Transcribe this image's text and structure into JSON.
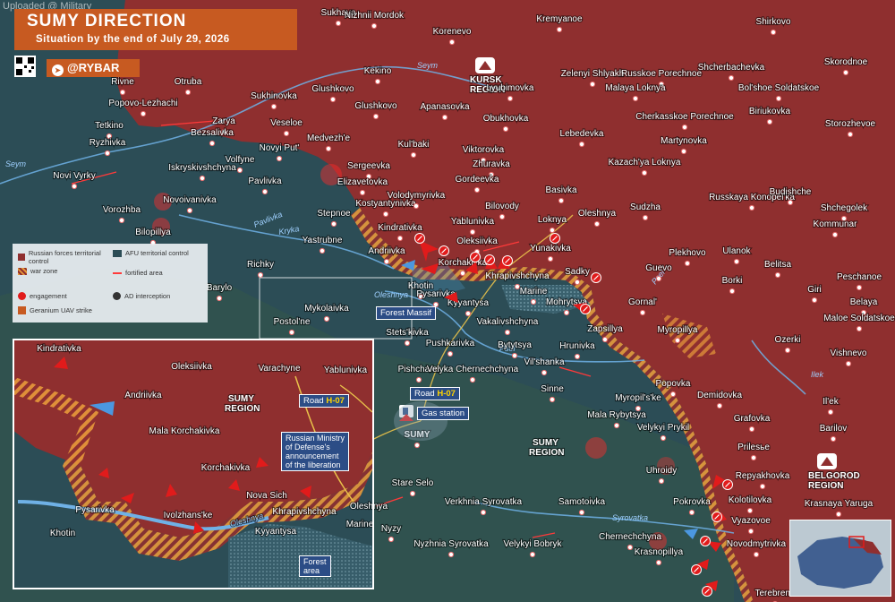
{
  "header": {
    "title": "SUMY DIRECTION",
    "subtitle": "Situation by the end of July 29, 2026",
    "uploaded_by": "Uploaded @ Military",
    "channel": "@RYBAR"
  },
  "colors": {
    "russian_control": "#8f2f2f",
    "afu_control": "#2c4d56",
    "war_zone": "#e89a3a",
    "accent": "#c75a21",
    "callout_bg": "#2c4d86"
  },
  "legend": {
    "items": [
      {
        "label": "Russian forces territorial control",
        "icon": "red-area-swatch"
      },
      {
        "label": "AFU territorial control",
        "icon": "blue-area-swatch"
      },
      {
        "label": "war zone",
        "icon": "hatched-swatch"
      },
      {
        "label": "fortified area",
        "icon": "red-line-swatch"
      },
      {
        "label": "engagement",
        "icon": "engagement-icon"
      },
      {
        "label": "AD interception",
        "icon": "interception-icon"
      },
      {
        "label": "Geranium UAV strike",
        "icon": "uav-strike-icon"
      }
    ]
  },
  "regions": {
    "kursk": "KURSK REGION",
    "sumy": "SUMY REGION",
    "belgorod": "BELGOROD REGION"
  },
  "rivers": {
    "seym": "Seym",
    "pavlivka": "Pavlivka",
    "krynka": "Kryka",
    "psel": "Psel",
    "oleshnya": "Oleshnya",
    "syrovatka": "Syrovatka",
    "ilek": "Ilek"
  },
  "callouts": {
    "forest_massif": "Forest Massif",
    "road_main": "Road ",
    "road_code": "H-07",
    "gas_station": "Gas station",
    "inset_road_main": "Road ",
    "inset_road_code": "H-07",
    "ministry_line1": "Russian Ministry",
    "ministry_line2": "of Defense's",
    "ministry_line3": "announcement",
    "ministry_line4": "of the liberation",
    "forest_area_line1": "Forest",
    "forest_area_line2": "area"
  },
  "settlements": [
    {
      "name": "Sukhaya"
    },
    {
      "name": "Nizhnii Mordok"
    },
    {
      "name": "Korenevo"
    },
    {
      "name": "Kremyanoe"
    },
    {
      "name": "Shirkovo"
    },
    {
      "name": "Rivne"
    },
    {
      "name": "Otruba"
    },
    {
      "name": "Kekino"
    },
    {
      "name": "Glushkovo"
    },
    {
      "name": "Shcherbachevka"
    },
    {
      "name": "Skorodnoe"
    },
    {
      "name": "Popovo-Lezhachi"
    },
    {
      "name": "Sukhinovka"
    },
    {
      "name": "Zelenyi Shlyakh"
    },
    {
      "name": "Russkoe Porechnoe"
    },
    {
      "name": "Lyubimovka"
    },
    {
      "name": "Malaya Loknya"
    },
    {
      "name": "Bol'shoe Soldatskoe"
    },
    {
      "name": "Tetkino"
    },
    {
      "name": "Zarya"
    },
    {
      "name": "Veseloe"
    },
    {
      "name": "Glushkovo"
    },
    {
      "name": "Apanasovka"
    },
    {
      "name": "Obukhovka"
    },
    {
      "name": "Cherkasskoe Porechnoe"
    },
    {
      "name": "Biriukovka"
    },
    {
      "name": "Storozhevoe"
    },
    {
      "name": "Bezsalivka"
    },
    {
      "name": "Medvezh'e"
    },
    {
      "name": "Kul'baki"
    },
    {
      "name": "Lebedevka"
    },
    {
      "name": "Ryzhivka"
    },
    {
      "name": "Volfyne"
    },
    {
      "name": "Novyi Put'"
    },
    {
      "name": "Viktorovka"
    },
    {
      "name": "Martynovka"
    },
    {
      "name": "Iskryskivshchyna"
    },
    {
      "name": "Sergeevka"
    },
    {
      "name": "Zhuravka"
    },
    {
      "name": "Kazach'ya Loknya"
    },
    {
      "name": "Novi Vyrky"
    },
    {
      "name": "Pavlivka"
    },
    {
      "name": "Elizavetovka"
    },
    {
      "name": "Gordeevka"
    },
    {
      "name": "Basivka"
    },
    {
      "name": "Vorozhba"
    },
    {
      "name": "Novoivanivka"
    },
    {
      "name": "Kostyantynivka"
    },
    {
      "name": "Volodymyrivka"
    },
    {
      "name": "Bilovody"
    },
    {
      "name": "Sudzha"
    },
    {
      "name": "Russkaya Konopel'ka"
    },
    {
      "name": "Budishche"
    },
    {
      "name": "Shchegolek"
    },
    {
      "name": "Stepnoe"
    },
    {
      "name": "Yablunivka"
    },
    {
      "name": "Loknya"
    },
    {
      "name": "Oleshnya"
    },
    {
      "name": "Bilopillya"
    },
    {
      "name": "Kommunar"
    },
    {
      "name": "Kindrativka"
    },
    {
      "name": "Yastrubne"
    },
    {
      "name": "Oleksiivka"
    },
    {
      "name": "Yunakivka"
    },
    {
      "name": "Andriivka"
    },
    {
      "name": "Richky"
    },
    {
      "name": "Sadky"
    },
    {
      "name": "Plekhovo"
    },
    {
      "name": "Ulanok"
    },
    {
      "name": "Korchakivka"
    },
    {
      "name": "Khrapivshchyna"
    },
    {
      "name": "Guevo"
    },
    {
      "name": "Belitsa"
    },
    {
      "name": "Barylo"
    },
    {
      "name": "Khotin"
    },
    {
      "name": "Pysarivka"
    },
    {
      "name": "Marine"
    },
    {
      "name": "Borki"
    },
    {
      "name": "Giri"
    },
    {
      "name": "Peschanoe"
    },
    {
      "name": "Mykolaivka"
    },
    {
      "name": "Kyyantysa"
    },
    {
      "name": "Mohrytsya"
    },
    {
      "name": "Gornal'"
    },
    {
      "name": "Postol'ne"
    },
    {
      "name": "Vakalivshchyna"
    },
    {
      "name": "Belaya"
    },
    {
      "name": "Maloe Soldatskoe"
    },
    {
      "name": "Stets'kivka"
    },
    {
      "name": "Pushkarivka"
    },
    {
      "name": "Bytytsya"
    },
    {
      "name": "Zapsillya"
    },
    {
      "name": "Myropillya"
    },
    {
      "name": "Ozerki"
    },
    {
      "name": "Hrunivka"
    },
    {
      "name": "Vishnevo"
    },
    {
      "name": "Pishchane"
    },
    {
      "name": "Velyka Chernechchyna"
    },
    {
      "name": "Vil'shanka"
    },
    {
      "name": "Sinne"
    },
    {
      "name": "Popovka"
    },
    {
      "name": "Myropil's'ke"
    },
    {
      "name": "Demidovka"
    },
    {
      "name": "Il'ek"
    },
    {
      "name": "Mala Rybytsya"
    },
    {
      "name": "Grafovka"
    },
    {
      "name": "Velykyi Prykil"
    },
    {
      "name": "Barilov"
    },
    {
      "name": "SUMY"
    },
    {
      "name": "Prilesье"
    },
    {
      "name": "Uhroidy"
    },
    {
      "name": "Repyakhovka"
    },
    {
      "name": "Stare Selo"
    },
    {
      "name": "Verkhnia Syrovatka"
    },
    {
      "name": "Samotoivka"
    },
    {
      "name": "Pokrovka"
    },
    {
      "name": "Kolotilovka"
    },
    {
      "name": "Krasnaya Yaruga"
    },
    {
      "name": "Vyazovoe"
    },
    {
      "name": "Nyzy"
    },
    {
      "name": "Nyzhnia Syrovatka"
    },
    {
      "name": "Chernechchyna"
    },
    {
      "name": "Novodmytrivka"
    },
    {
      "name": "Velykyi Bobryk"
    },
    {
      "name": "Krasnopillya"
    },
    {
      "name": "Terebreno"
    }
  ],
  "inset": {
    "region": "SUMY REGION",
    "settlements": [
      {
        "name": "Kindrativka"
      },
      {
        "name": "Oleksiivka"
      },
      {
        "name": "Yablunivka"
      },
      {
        "name": "Varachyne"
      },
      {
        "name": "Andriivka"
      },
      {
        "name": "Mala Korchakivka"
      },
      {
        "name": "Korchakivka"
      },
      {
        "name": "Nova Sich"
      },
      {
        "name": "Pysarivka"
      },
      {
        "name": "Ivolzhans'ke"
      },
      {
        "name": "Khrapivshchyna"
      },
      {
        "name": "Kyyantysa"
      },
      {
        "name": "Khotin"
      },
      {
        "name": "Marine"
      },
      {
        "name": "Oleshnya"
      }
    ]
  }
}
